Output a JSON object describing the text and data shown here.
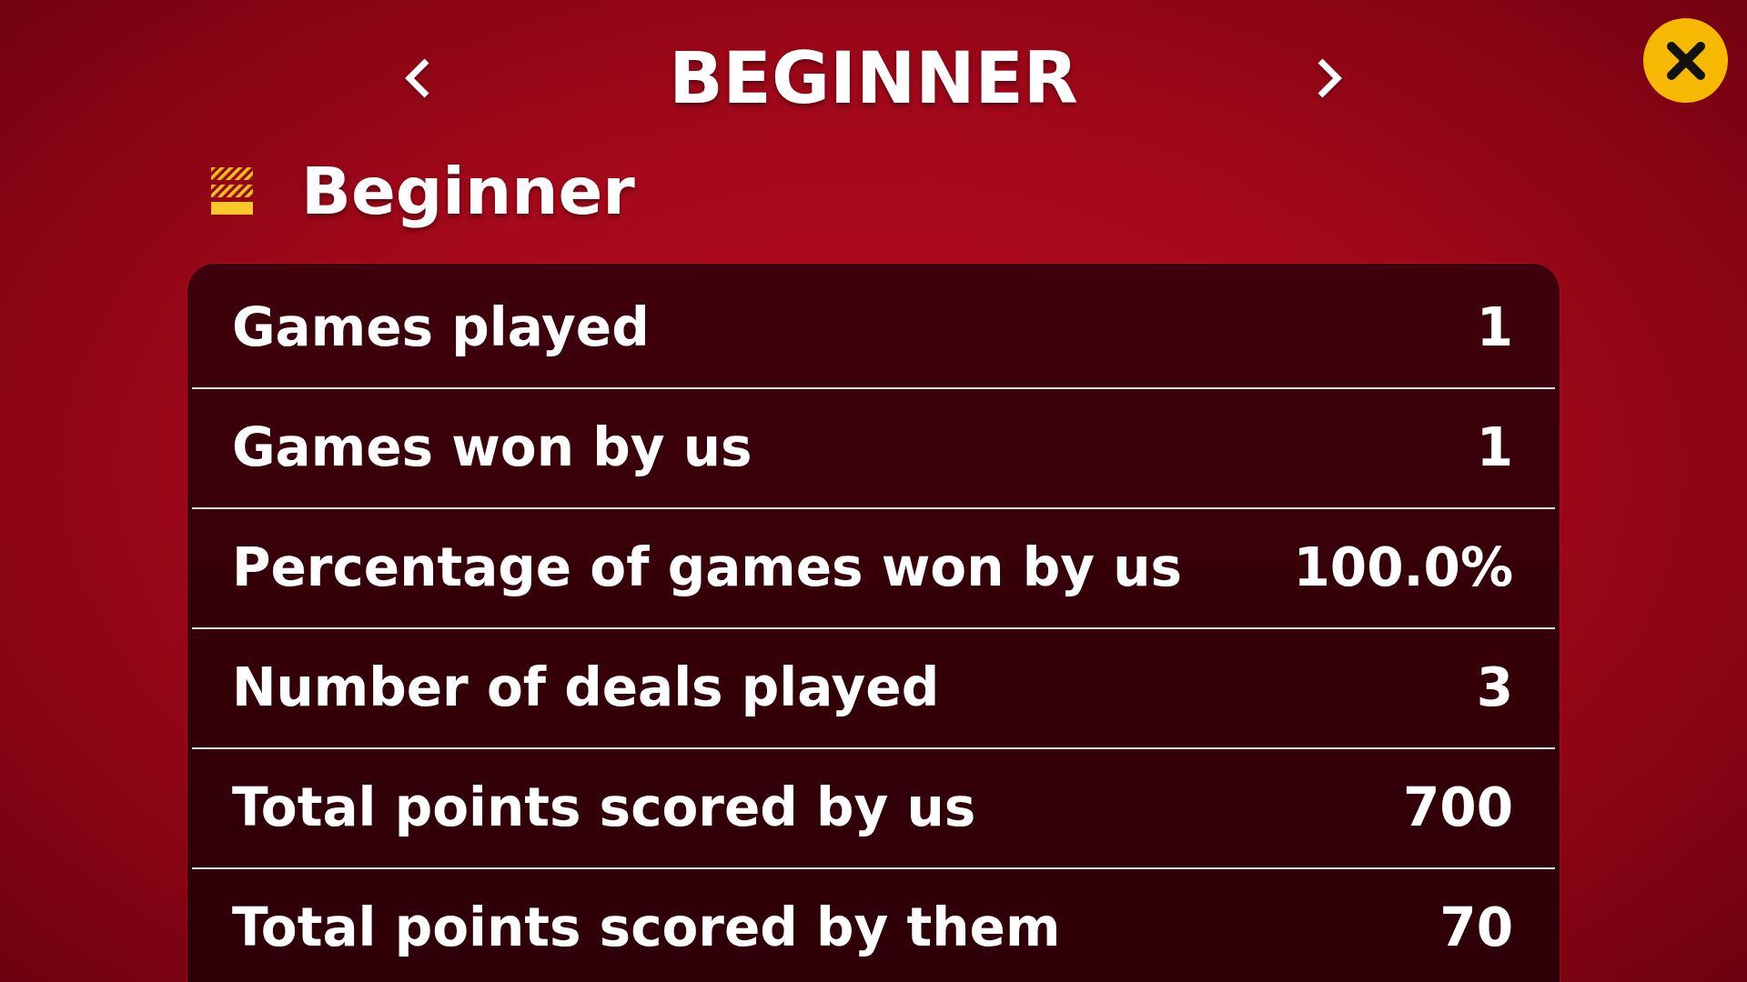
{
  "header": {
    "title": "BEGINNER"
  },
  "difficulty": {
    "name": "Beginner",
    "bars": [
      {
        "filled": false
      },
      {
        "filled": false
      },
      {
        "filled": true
      }
    ]
  },
  "stats": [
    {
      "label": "Games played",
      "value": "1"
    },
    {
      "label": "Games won by us",
      "value": "1"
    },
    {
      "label": "Percentage of games won by us",
      "value": "100.0%"
    },
    {
      "label": "Number of deals played",
      "value": "3"
    },
    {
      "label": "Total points scored by us",
      "value": "700"
    },
    {
      "label": "Total points scored by them",
      "value": "70"
    }
  ]
}
